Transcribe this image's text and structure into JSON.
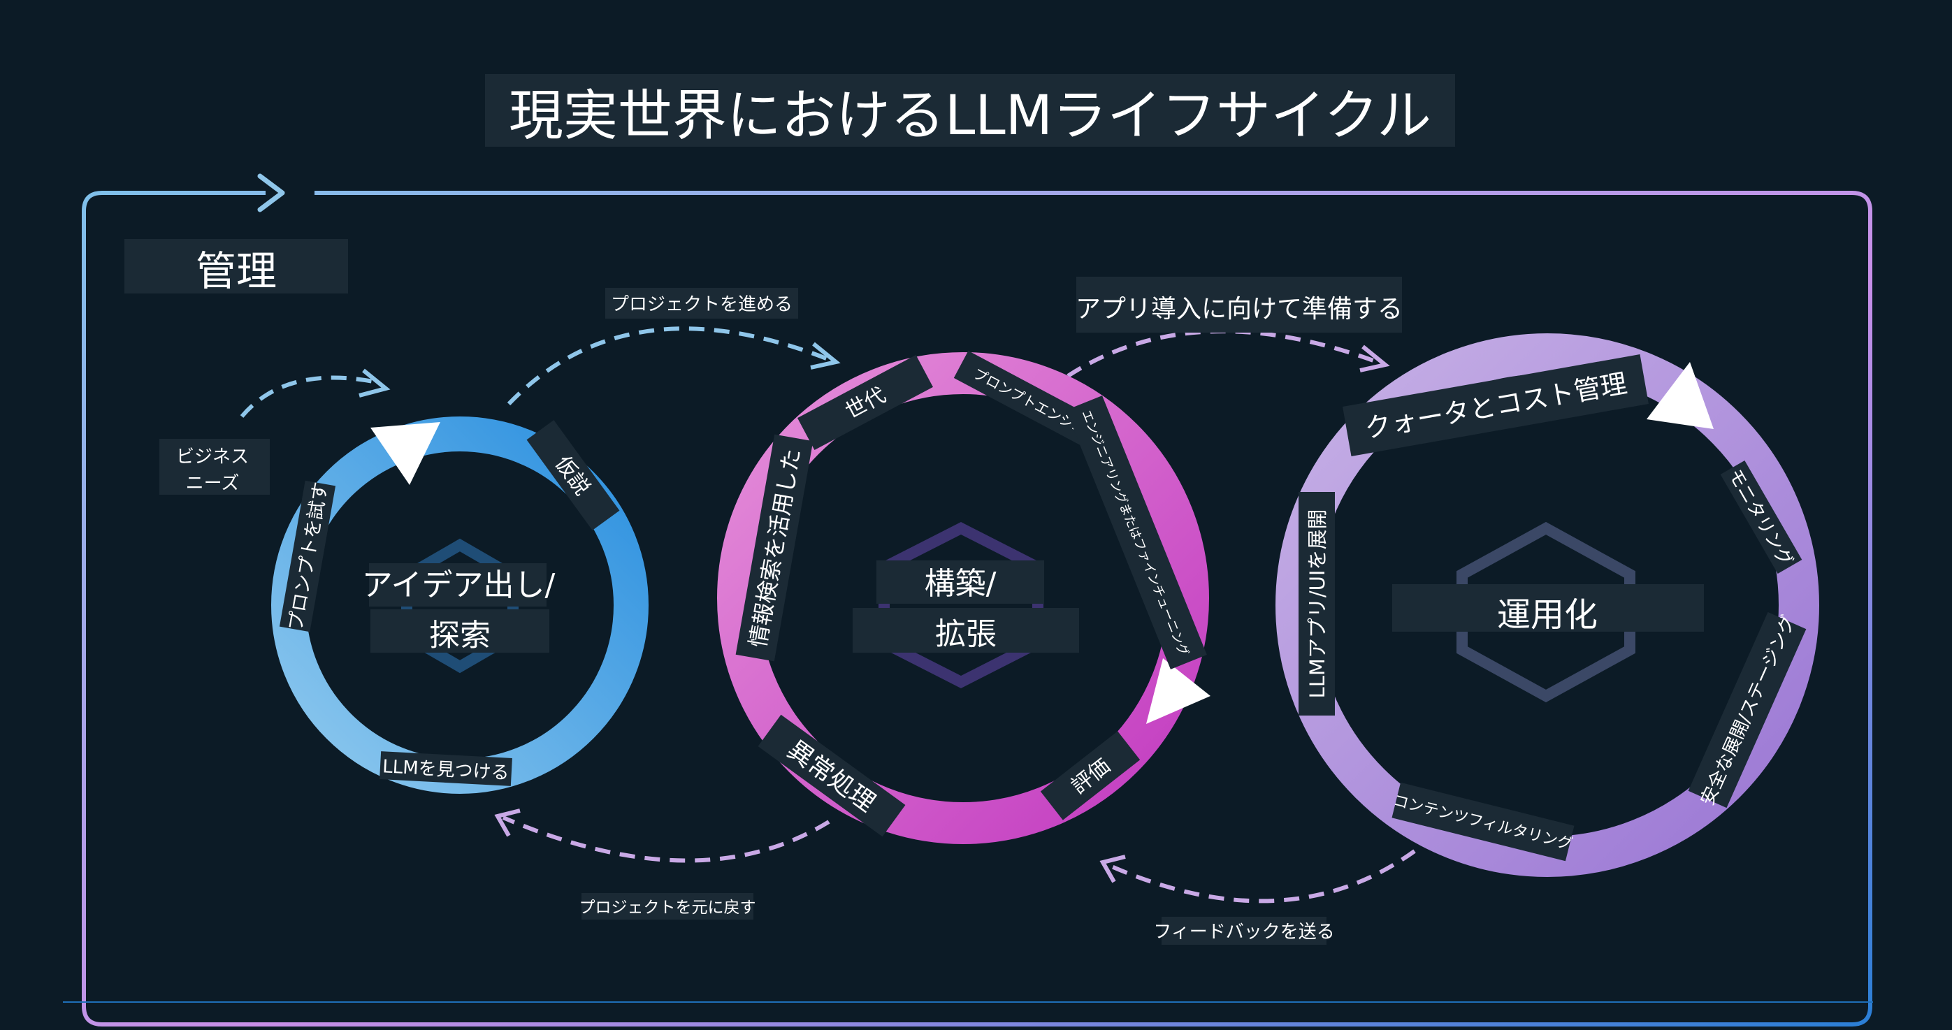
{
  "title": "現実世界におけるLLMライフサイクル",
  "management_label": "管理",
  "flow": {
    "business_needs_1": "ビジネス",
    "business_needs_2": "ニーズ",
    "advance_project": "プロジェクトを進める",
    "prepare_app": "アプリ導入に向けて準備する",
    "revert_project": "プロジェクトを元に戻す",
    "send_feedback": "フィードバックを送る"
  },
  "stages": {
    "ideation": {
      "title_line1": "アイデア出し/",
      "title_line2": "探索",
      "labels": {
        "hypothesis": "仮説",
        "try_prompts": "プロンプトを試す",
        "find_llm": "LLMを見つける"
      }
    },
    "building": {
      "title_line1": "構築/",
      "title_line2": "拡張",
      "labels": {
        "generation": "世代",
        "prompt_engineering": "プロンプトエンジニ",
        "eng_or_finetune": "エンジニアリングまたはファインチューニング",
        "retrieval": "情報検索を活用した",
        "exception": "異常処理",
        "evaluation": "評価"
      }
    },
    "operationalizing": {
      "title": "運用化",
      "labels": {
        "quota_cost": "クォータとコスト管理",
        "monitoring": "モニタリング",
        "deploy_app": "LLMアプリ/UIを展開",
        "safe_rollout": "安全な展開/ステージング",
        "content_filtering": "コンテンツフィルタリング"
      }
    }
  },
  "colors": {
    "background": "#0c1b26",
    "label_box": "#1b2a35",
    "ideation_ring_light": "#8fc9ee",
    "ideation_ring_dark": "#2a8fdf",
    "building_ring_light": "#e58fd9",
    "building_ring_dark": "#c23ac0",
    "operational_ring_light": "#c7b1e6",
    "operational_ring_dark": "#9a76d4",
    "frame_start": "#7fc0ea",
    "frame_mid": "#c98fe8",
    "frame_end": "#2b7fd6",
    "arrow_blue": "#8fc6ea",
    "arrow_lavender": "#c9a9e6"
  }
}
